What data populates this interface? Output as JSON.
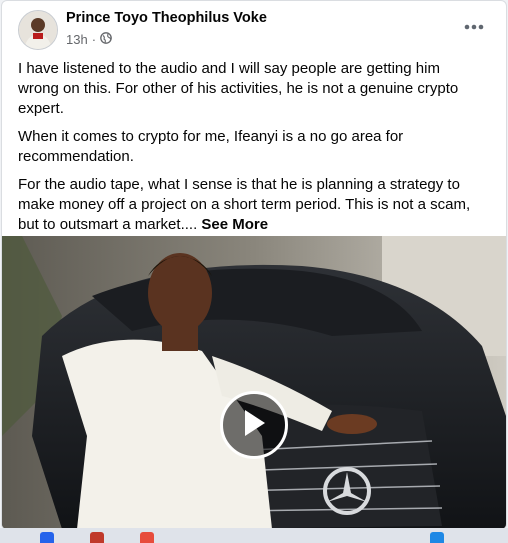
{
  "post": {
    "author": "Prince Toyo Theophilus Voke",
    "time": "13h",
    "separator": "·",
    "privacy_icon": "globe-icon",
    "paragraphs": [
      "I have listened to the audio and I will say people are getting him wrong on this. For other of his activities, he is not a genuine crypto expert.",
      "When it comes to crypto for me, Ifeanyi is a no go area for recommendation.",
      "For the audio tape, what I sense is that he is planning a strategy to make money off a project on a short term period. This is not a scam, but to outsmart a market...."
    ],
    "see_more": "See More"
  },
  "media": {
    "type": "video",
    "play_icon": "play-icon"
  },
  "colors": {
    "text": "#050505",
    "secondary": "#65676b",
    "background": "#f0f2f5"
  }
}
